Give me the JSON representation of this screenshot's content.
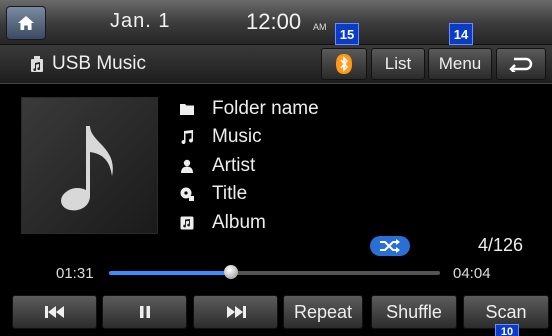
{
  "status": {
    "date": "Jan. 1",
    "time": "12:00",
    "ampm": "AM"
  },
  "callouts": {
    "bt": "15",
    "menu": "14",
    "scan": "10"
  },
  "titlebar": {
    "source_label": "USB Music",
    "list_label": "List",
    "menu_label": "Menu"
  },
  "track": {
    "folder": "Folder name",
    "music": "Music",
    "artist": "Artist",
    "title": "Title",
    "album": "Album",
    "count": "4/126"
  },
  "progress": {
    "current": "01:31",
    "total": "04:04",
    "fraction": 0.37
  },
  "controls": {
    "repeat": "Repeat",
    "shuffle": "Shuffle",
    "scan": "Scan"
  },
  "colors": {
    "accent": "#3a8dff",
    "callout": "#0a3cc8",
    "bt_icon": "#ff9a1a"
  },
  "icons": [
    "home-icon",
    "usb-music-icon",
    "bluetooth-icon",
    "back-icon",
    "folder-icon",
    "music-note-icon",
    "artist-icon",
    "title-icon",
    "album-icon",
    "shuffle-icon",
    "prev-track-icon",
    "pause-icon",
    "next-track-icon"
  ]
}
